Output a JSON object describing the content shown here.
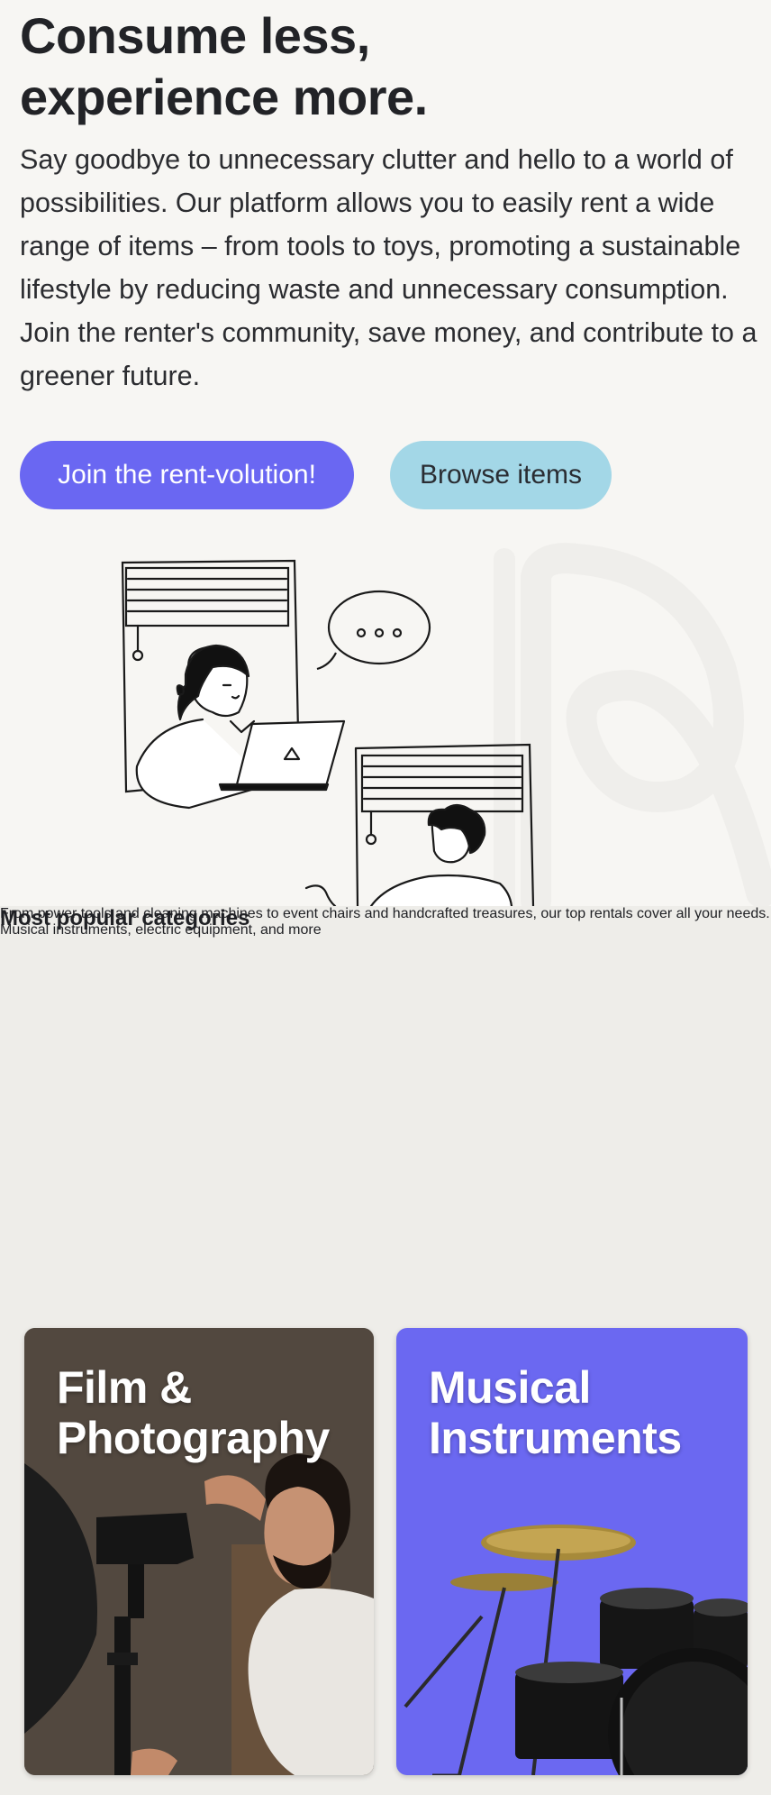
{
  "hero": {
    "heading_line1": "Consume less,",
    "heading_line2": "experience more.",
    "description": "Say goodbye to unnecessary clutter and hello to a world of possibilities. Our platform allows you to easily rent a wide range of items – from tools to toys, promoting a sustainable lifestyle by reducing waste and unnecessary consumption. Join the renter's community, save money, and contribute to a greener future.",
    "primary_button": "Join the rent-volution!",
    "secondary_button": "Browse items"
  },
  "categories": {
    "heading": "Most popular categories",
    "description": "From power tools and cleaning machines to event chairs and handcrafted treasures, our top rentals cover all your needs. Musical instruments, electric equipment, and more",
    "cards": [
      {
        "line1": "Film &",
        "line2": "Photography"
      },
      {
        "line1": "Musical",
        "line2": "Instruments"
      }
    ]
  },
  "colors": {
    "primary": "#6a67f2",
    "secondary": "#a3d7e7",
    "page_bg": "#f7f6f3",
    "section_bg": "#eeede9"
  }
}
